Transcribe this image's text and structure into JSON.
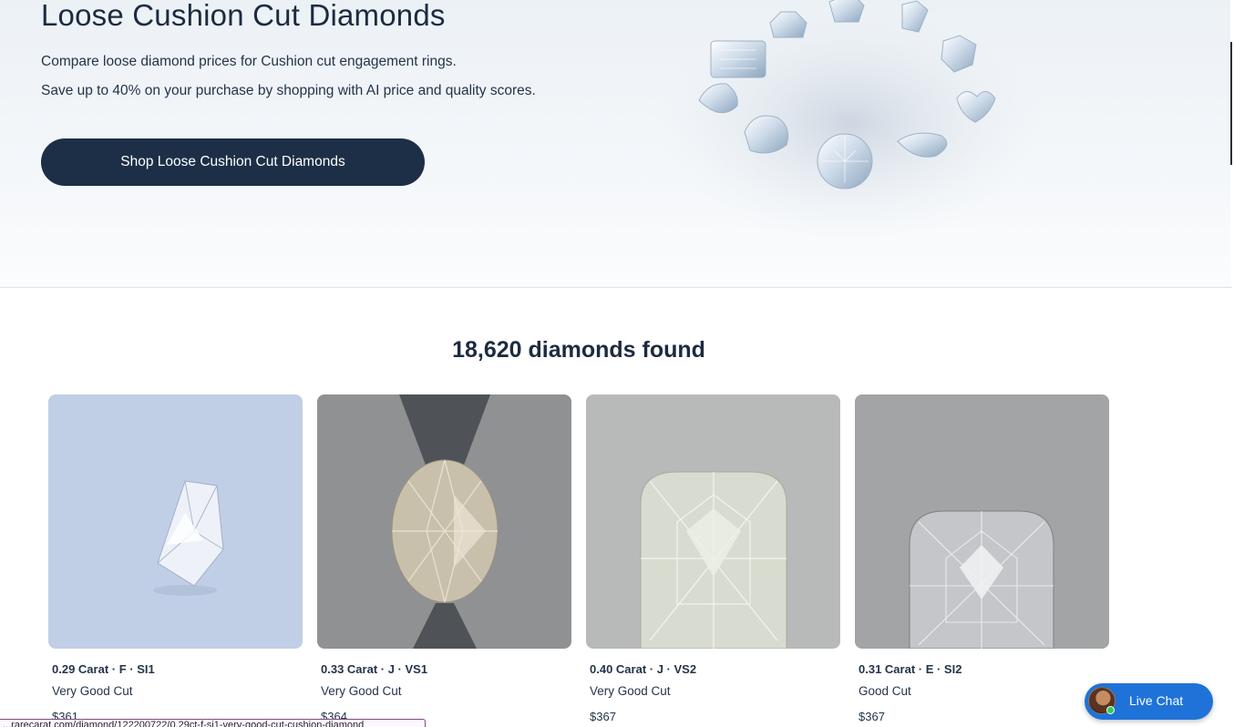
{
  "hero": {
    "title": "Loose Cushion Cut Diamonds",
    "line1": "Compare loose diamond prices for Cushion cut engagement rings.",
    "line2": "Save up to 40% on your purchase by shopping with AI price and quality scores.",
    "cta_label": "Shop Loose Cushion Cut Diamonds"
  },
  "results": {
    "count_label": "18,620 diamonds found"
  },
  "cards": [
    {
      "spec": "0.29 Carat · F · SI1",
      "cut": "Very Good Cut",
      "price": "$361"
    },
    {
      "spec": "0.33 Carat · J · VS1",
      "cut": "Very Good Cut",
      "price": "$364"
    },
    {
      "spec": "0.40 Carat · J · VS2",
      "cut": "Very Good Cut",
      "price": "$367"
    },
    {
      "spec": "0.31 Carat · E · SI2",
      "cut": "Good Cut",
      "price": "$367"
    }
  ],
  "live_chat": {
    "label": "Live Chat"
  },
  "status_bar": {
    "url": "...rarecarat.com/diamond/122200722/0.29ct-f-si1-very-good-cut-cushion-diamond"
  },
  "colors": {
    "primary_dark": "#1c2f47",
    "chat_blue": "#1f72d8",
    "online_green": "#2fcf4b"
  }
}
